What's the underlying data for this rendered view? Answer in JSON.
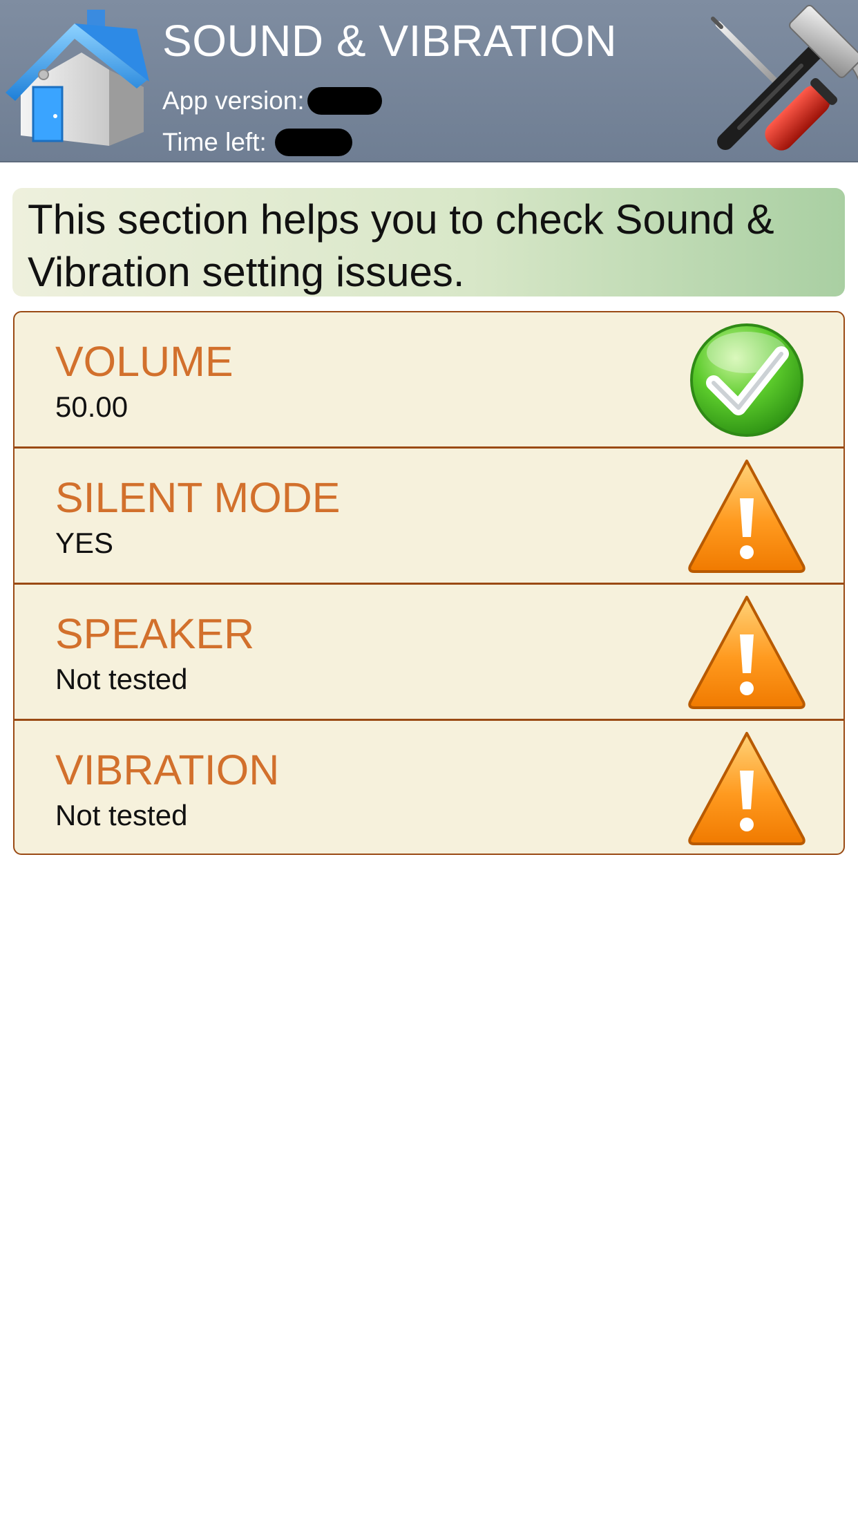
{
  "header": {
    "title": "SOUND & VIBRATION",
    "app_version_label": "App version:",
    "time_left_label": "Time left:",
    "left_icon": "house-icon",
    "right_icon": "tools-icon",
    "background_color": "#76859a"
  },
  "info": {
    "text": "This section helps you to check Sound & Vibration setting issues."
  },
  "checks": [
    {
      "label": "VOLUME",
      "value": "50.00",
      "status": "ok",
      "icon": "checkmark-icon"
    },
    {
      "label": "SILENT MODE",
      "value": "YES",
      "status": "warning",
      "icon": "warning-icon"
    },
    {
      "label": "SPEAKER",
      "value": "Not tested",
      "status": "warning",
      "icon": "warning-icon"
    },
    {
      "label": "VIBRATION",
      "value": "Not tested",
      "status": "warning",
      "icon": "warning-icon"
    }
  ],
  "colors": {
    "label_orange": "#d2702c",
    "row_background": "#f6f1dc",
    "row_border": "#9a4a14"
  }
}
